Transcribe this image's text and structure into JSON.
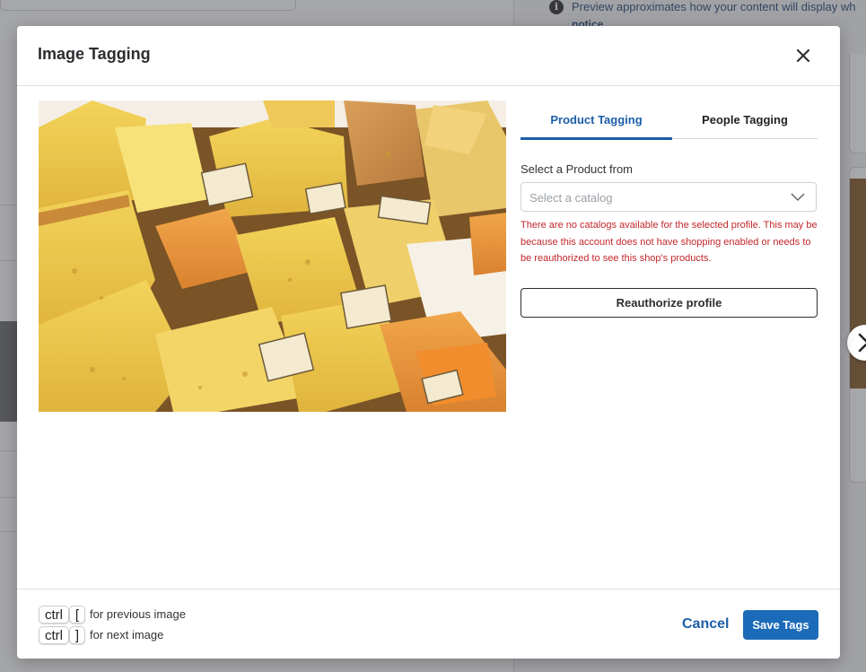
{
  "background": {
    "info_text": "Preview approximates how your content will display wh",
    "info_link": "notice"
  },
  "modal": {
    "title": "Image Tagging",
    "tabs": [
      {
        "label": "Product Tagging",
        "active": true
      },
      {
        "label": "People Tagging",
        "active": false
      }
    ],
    "select_label": "Select a Product from",
    "select_placeholder": "Select a catalog",
    "error_message": "There are no catalogs available for the selected profile. This may be because this account does not have shopping enabled or needs to be reauthorized to see this shop's products.",
    "reauthorize_label": "Reauthorize profile"
  },
  "footer": {
    "shortcuts": [
      {
        "modifier": "ctrl",
        "key": "[",
        "description": "for previous image"
      },
      {
        "modifier": "ctrl",
        "key": "]",
        "description": "for next image"
      }
    ],
    "cancel_label": "Cancel",
    "save_label": "Save Tags"
  },
  "colors": {
    "accent": "#1c5ea8",
    "primary_button": "#1c6bb8",
    "error": "#c3272b"
  },
  "icons": {
    "close": "close-icon",
    "chevron": "chevron-down-icon",
    "next": "chevron-right-icon",
    "info": "info-icon"
  }
}
